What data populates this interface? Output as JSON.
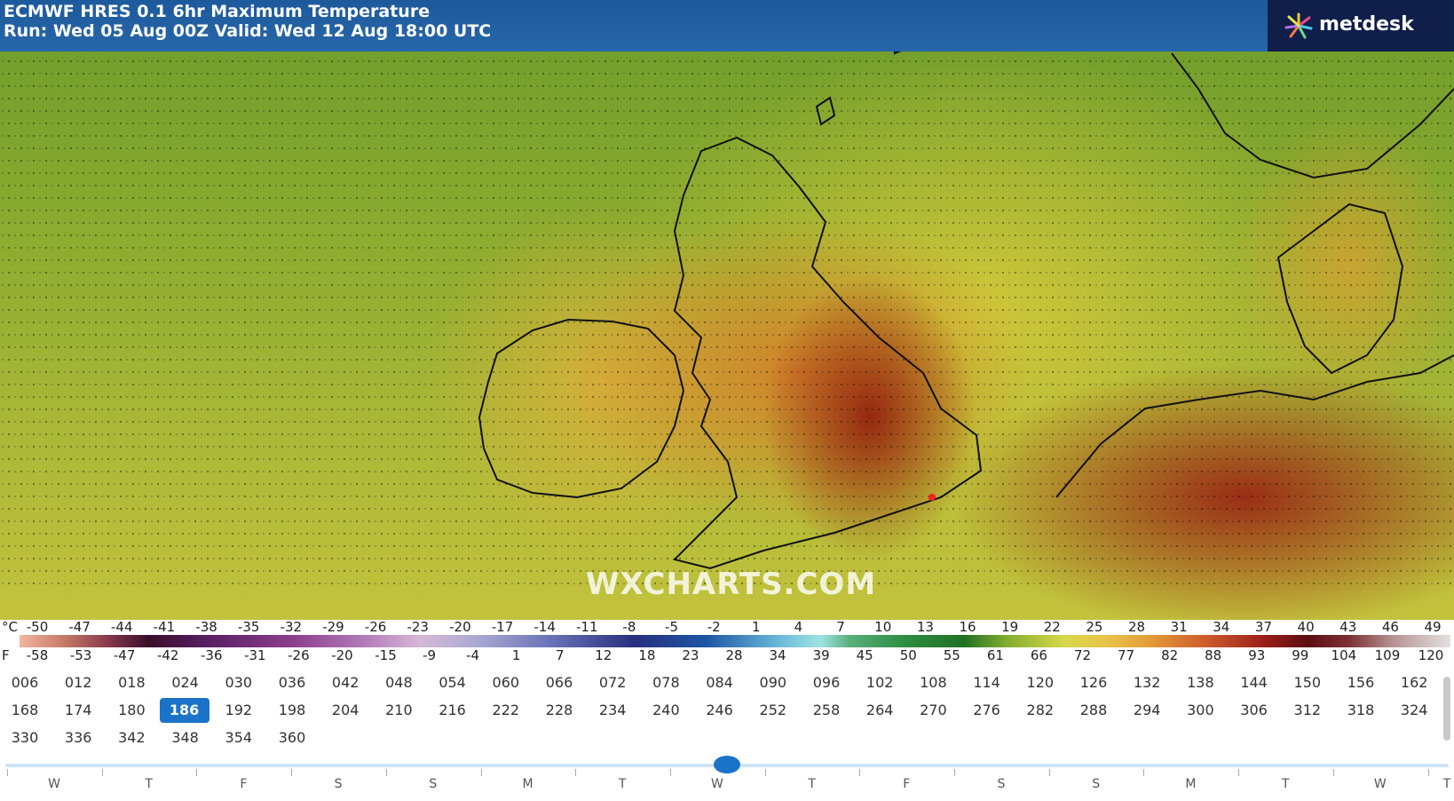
{
  "header": {
    "title_line1": "ECMWF HRES 0.1 6hr Maximum Temperature",
    "title_line2": "Run: Wed 05 Aug 00Z Valid: Wed 12 Aug 18:00 UTC",
    "logo_text": "metdesk",
    "logo_icon": "starburst-logo-icon"
  },
  "watermark": "WXCHARTS.COM",
  "scale": {
    "celsius_unit": "°C",
    "celsius_ticks": [
      "-50",
      "-47",
      "-44",
      "-41",
      "-38",
      "-35",
      "-32",
      "-29",
      "-26",
      "-23",
      "-20",
      "-17",
      "-14",
      "-11",
      "-8",
      "-5",
      "-2",
      "1",
      "4",
      "7",
      "10",
      "13",
      "16",
      "19",
      "22",
      "25",
      "28",
      "31",
      "34",
      "37",
      "40",
      "43",
      "46",
      "49"
    ],
    "fahrenheit_unit": "F",
    "fahrenheit_ticks": [
      "-58",
      "-53",
      "-47",
      "-42",
      "-36",
      "-31",
      "-26",
      "-20",
      "-15",
      "-9",
      "-4",
      "1",
      "7",
      "12",
      "18",
      "23",
      "28",
      "34",
      "39",
      "45",
      "50",
      "55",
      "61",
      "66",
      "72",
      "77",
      "82",
      "88",
      "93",
      "99",
      "104",
      "109",
      "120"
    ]
  },
  "timesteps": {
    "rows": [
      [
        "006",
        "012",
        "018",
        "024",
        "030",
        "036",
        "042",
        "048",
        "054",
        "060",
        "066",
        "072",
        "078",
        "084",
        "090",
        "096",
        "102",
        "108",
        "114",
        "120",
        "126",
        "132",
        "138",
        "144",
        "150",
        "156",
        "162"
      ],
      [
        "168",
        "174",
        "180",
        "186",
        "192",
        "198",
        "204",
        "210",
        "216",
        "222",
        "228",
        "234",
        "240",
        "246",
        "252",
        "258",
        "264",
        "270",
        "276",
        "282",
        "288",
        "294",
        "300",
        "306",
        "312",
        "318",
        "324"
      ],
      [
        "330",
        "336",
        "342",
        "348",
        "354",
        "360"
      ]
    ],
    "selected": "186",
    "slider_position_fraction": 0.5
  },
  "day_axis": [
    "W",
    "T",
    "F",
    "S",
    "S",
    "M",
    "T",
    "W",
    "T",
    "F",
    "S",
    "S",
    "M",
    "T",
    "W",
    "T"
  ],
  "colors": {
    "accent": "#1a73c9",
    "title_bar": "#2766a8",
    "logo_bg": "#0f1f4a"
  }
}
